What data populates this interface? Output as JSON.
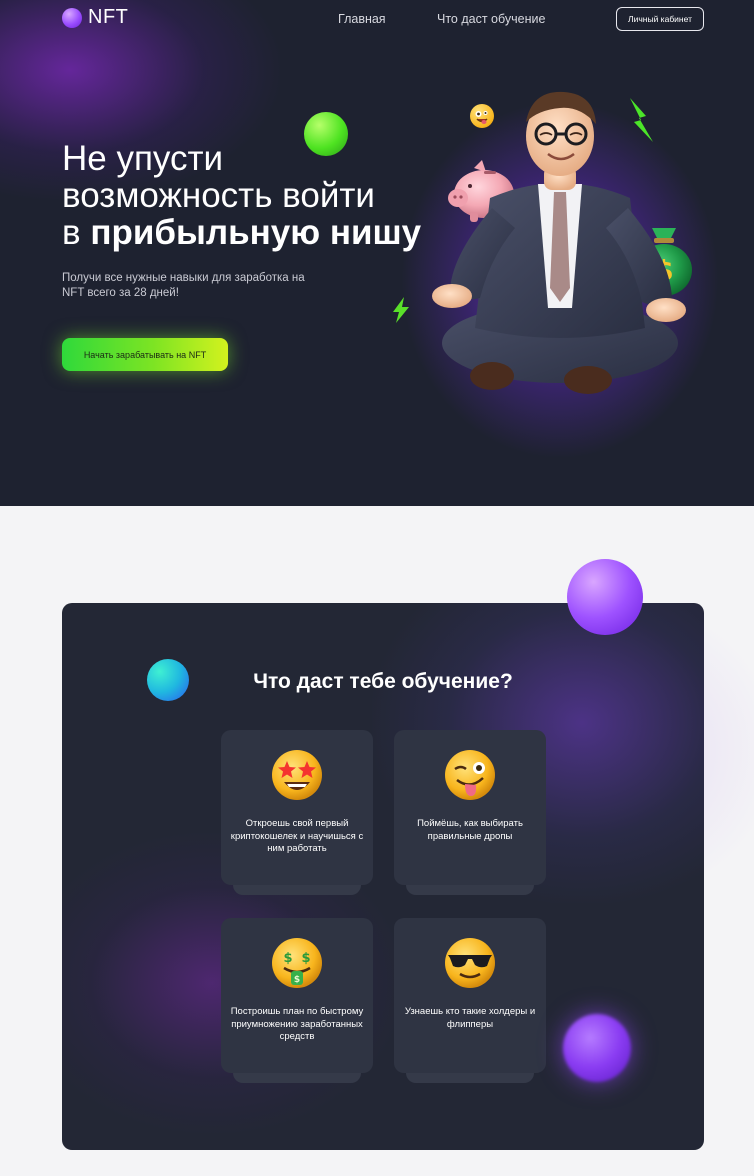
{
  "header": {
    "logo_text": "NFT",
    "nav": [
      {
        "label": "Главная"
      },
      {
        "label": "Что даст обучение"
      }
    ],
    "cabinet_button": "Личный кабинет"
  },
  "hero": {
    "title_line1": "Не упусти",
    "title_line2": "возможность войти",
    "title_line3_prefix": "в ",
    "title_line3_bold": "прибыльную нишу",
    "subtitle": "Получи все нужные навыки для заработка на NFT всего за 28 дней!",
    "cta_button": "Начать зарабатывать на NFT"
  },
  "learning": {
    "title": "Что даст тебе обучение?",
    "features": [
      {
        "text": "Откроешь свой первый криптокошелек и научишься с ним работать",
        "icon": "star-struck-emoji-icon"
      },
      {
        "text": "Поймёшь, как выбирать правильные дропы",
        "icon": "winking-tongue-emoji-icon"
      },
      {
        "text": "Построишь план по быстрому приумножению заработанных средств",
        "icon": "money-mouth-emoji-icon"
      },
      {
        "text": "Узнаешь кто такие холдеры и флипперы",
        "icon": "sunglasses-emoji-icon"
      }
    ]
  },
  "colors": {
    "hero_bg": "#1e2230",
    "accent_green": "#7de423",
    "accent_purple": "#9e52ff",
    "card_bg": "#232735"
  }
}
